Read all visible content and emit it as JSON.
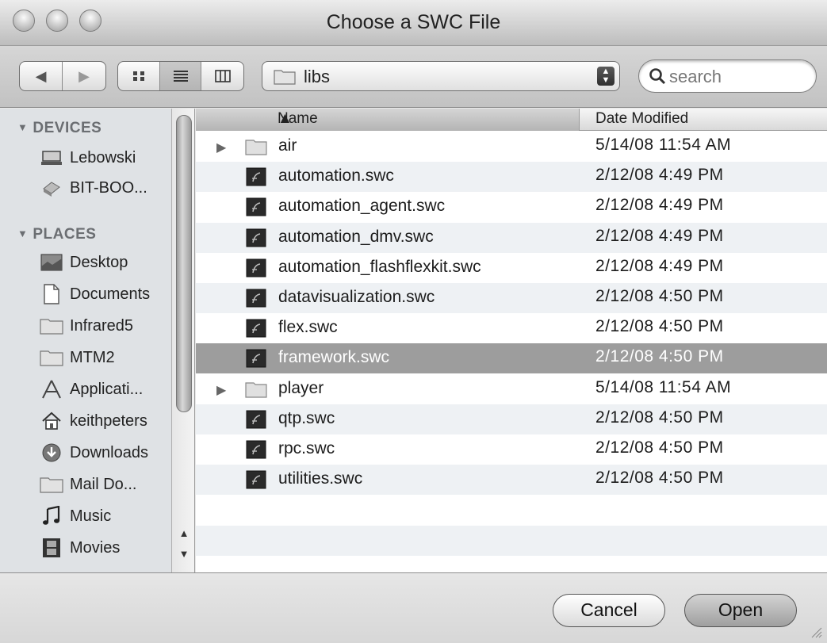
{
  "window": {
    "title": "Choose a SWC File"
  },
  "toolbar": {
    "back_icon": "back-arrow-icon",
    "forward_icon": "forward-arrow-icon",
    "view_icons": [
      "icon-view-icon",
      "list-view-icon",
      "column-view-icon"
    ],
    "active_view": "list",
    "location": "libs",
    "search_placeholder": "search"
  },
  "sidebar": {
    "devices_label": "DEVICES",
    "devices": [
      {
        "label": "Lebowski",
        "icon": "computer-icon"
      },
      {
        "label": "BIT-BOO...",
        "icon": "network-drive-icon"
      }
    ],
    "places_label": "PLACES",
    "places": [
      {
        "label": "Desktop",
        "icon": "desktop-icon"
      },
      {
        "label": "Documents",
        "icon": "documents-icon"
      },
      {
        "label": "Infrared5",
        "icon": "folder-icon"
      },
      {
        "label": "MTM2",
        "icon": "folder-icon"
      },
      {
        "label": "Applicati...",
        "icon": "applications-icon"
      },
      {
        "label": "keithpeters",
        "icon": "home-icon"
      },
      {
        "label": "Downloads",
        "icon": "downloads-icon"
      },
      {
        "label": "Mail Do...",
        "icon": "folder-icon"
      },
      {
        "label": "Music",
        "icon": "music-icon"
      },
      {
        "label": "Movies",
        "icon": "movies-icon"
      }
    ]
  },
  "columns": {
    "name": "Name",
    "date": "Date Modified"
  },
  "files": [
    {
      "name": "air",
      "date": "5/14/08 11:54 AM",
      "type": "folder"
    },
    {
      "name": "automation.swc",
      "date": "2/12/08 4:49 PM",
      "type": "swc"
    },
    {
      "name": "automation_agent.swc",
      "date": "2/12/08 4:49 PM",
      "type": "swc"
    },
    {
      "name": "automation_dmv.swc",
      "date": "2/12/08 4:49 PM",
      "type": "swc"
    },
    {
      "name": "automation_flashflexkit.swc",
      "date": "2/12/08 4:49 PM",
      "type": "swc"
    },
    {
      "name": "datavisualization.swc",
      "date": "2/12/08 4:50 PM",
      "type": "swc"
    },
    {
      "name": "flex.swc",
      "date": "2/12/08 4:50 PM",
      "type": "swc"
    },
    {
      "name": "framework.swc",
      "date": "2/12/08 4:50 PM",
      "type": "swc",
      "selected": true
    },
    {
      "name": "player",
      "date": "5/14/08 11:54 AM",
      "type": "folder"
    },
    {
      "name": "qtp.swc",
      "date": "2/12/08 4:50 PM",
      "type": "swc"
    },
    {
      "name": "rpc.swc",
      "date": "2/12/08 4:50 PM",
      "type": "swc"
    },
    {
      "name": "utilities.swc",
      "date": "2/12/08 4:50 PM",
      "type": "swc"
    }
  ],
  "buttons": {
    "cancel": "Cancel",
    "open": "Open"
  }
}
